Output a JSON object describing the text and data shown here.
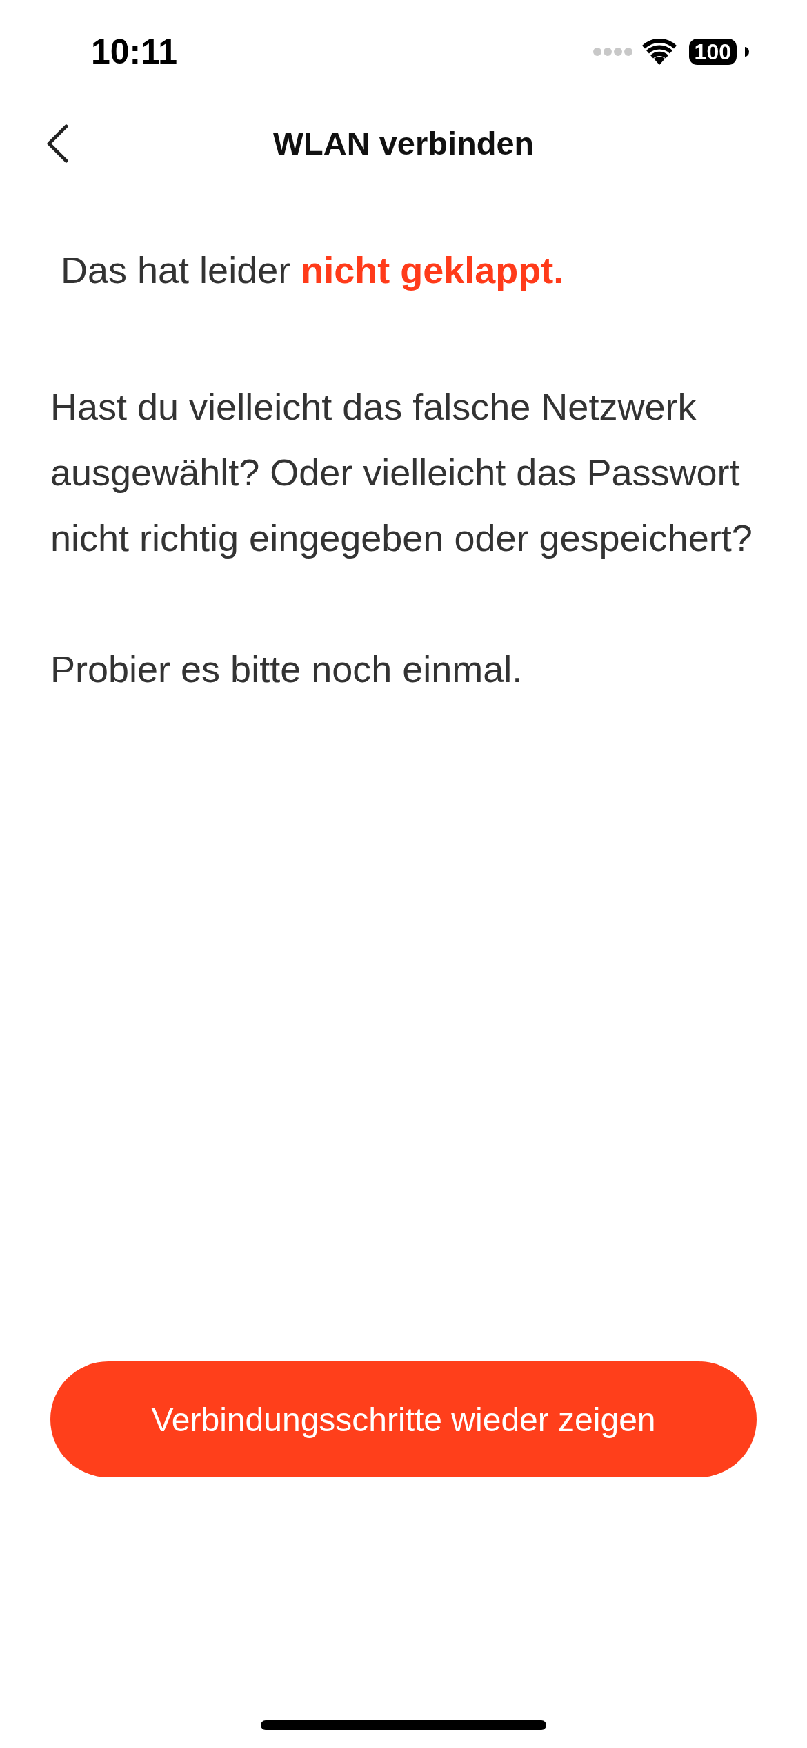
{
  "status_bar": {
    "time": "10:11",
    "battery": "100"
  },
  "nav": {
    "title": "WLAN verbinden"
  },
  "headline": "Das hat leider **nicht geklappt.**",
  "paragraphs": [
    "Hast du vielleicht das falsche Netzwerk ausgewählt? Oder vielleicht das Passwort nicht richtig eingegeben oder gespeichert?",
    "Probier es bitte noch einmal."
  ],
  "button": {
    "label": "Verbindungsschritte wieder zeigen"
  }
}
